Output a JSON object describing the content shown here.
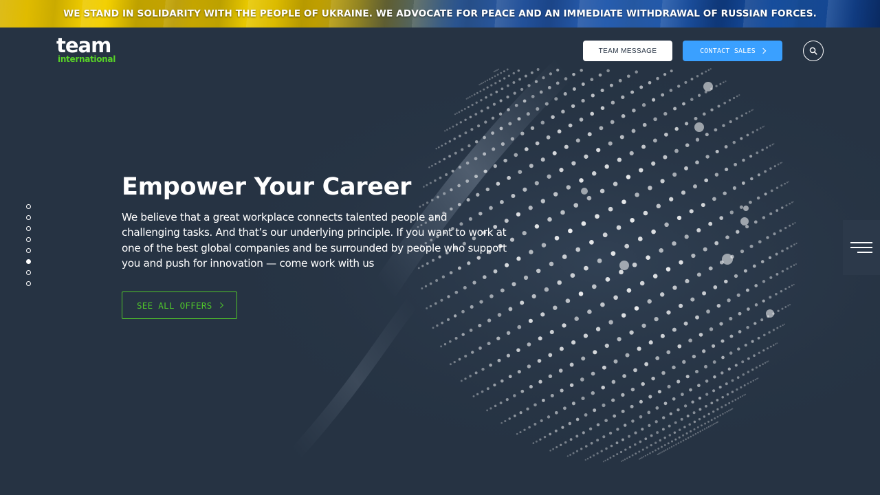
{
  "banner": {
    "text": "WE STAND IN SOLIDARITY WITH THE PEOPLE OF UKRAINE. WE ADVOCATE FOR PEACE AND AN IMMEDIATE WITHDRAWAL OF RUSSIAN FORCES."
  },
  "header": {
    "logo_word": "team",
    "logo_sub": "international",
    "team_message_label": "TEAM MESSAGE",
    "contact_sales_label": "CONTACT SALES",
    "search_icon": "search-icon"
  },
  "hero": {
    "title": "Empower Your Career",
    "text": "We believe that a great workplace connects talented people and challenging tasks. And that’s our underlying principle. If you want to work at one of the best global companies and be surrounded by people who support you and push for innovation — come work with us",
    "cta_label": "SEE ALL OFFERS",
    "slides_total": 8,
    "active_slide": 6
  },
  "menu": {
    "icon": "hamburger-menu-icon"
  },
  "colors": {
    "background": "#263343",
    "accent_green": "#4fc52b",
    "contact_blue": "#3aa0ff",
    "logo_green": "#57d227"
  }
}
